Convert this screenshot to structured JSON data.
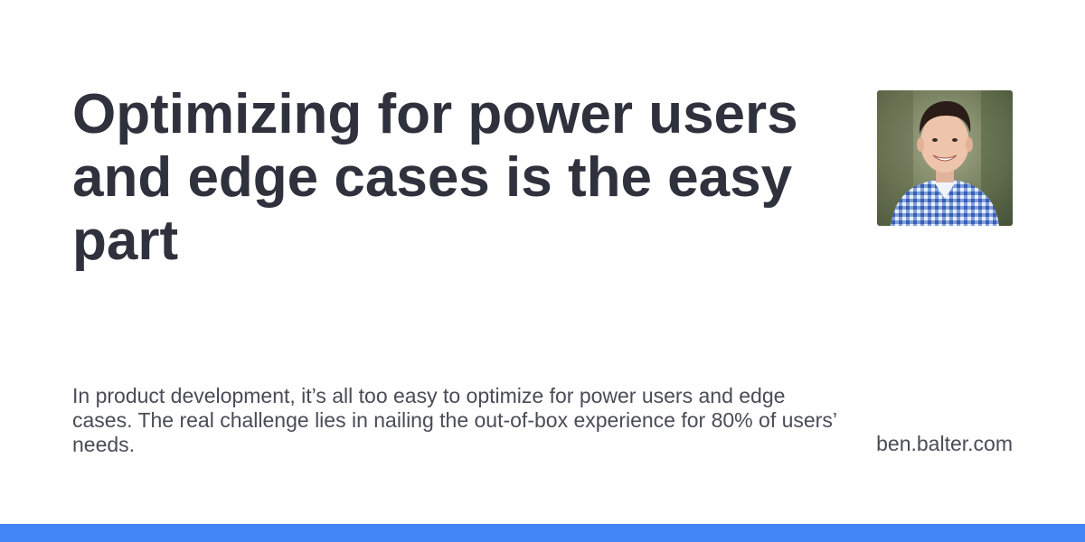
{
  "title": "Optimizing for power users and edge cases is the easy part",
  "description": "In product development, it’s all too easy to optimize for power users and edge cases. The real challenge lies in nailing the out-of-box experience for 80% of users’ needs.",
  "site": "ben.balter.com",
  "colors": {
    "title": "#2f313d",
    "body_text": "#4a4c56",
    "accent_bar": "#4285f4",
    "background": "#ffffff"
  }
}
